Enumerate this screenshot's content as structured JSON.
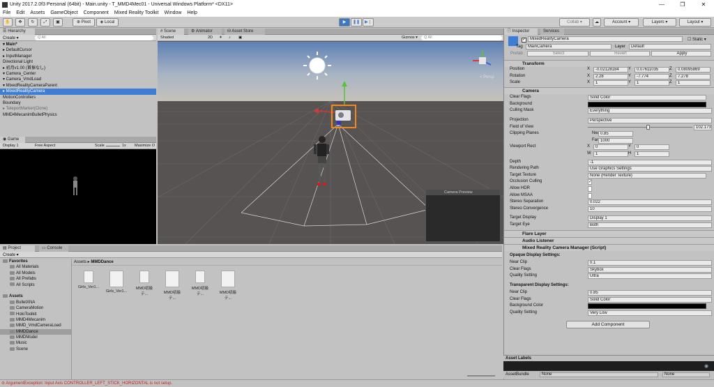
{
  "window": {
    "title": "Unity 2017.2.0f3 Personal (64bit) - Main.unity - T_MMD4Mec01 - Universal Windows Platform* <DX11>",
    "controls": [
      "—",
      "❐",
      "✕"
    ]
  },
  "menu": [
    "File",
    "Edit",
    "Assets",
    "GameObject",
    "Component",
    "Mixed Reality Toolkit",
    "Window",
    "Help"
  ],
  "toolbar": {
    "pivot": "Pivot",
    "local": "Local",
    "collab": "Collab ▾",
    "account": "Account",
    "layers": "Layers",
    "layout": "Layout"
  },
  "hierarchy": {
    "tab": "Hierarchy",
    "create": "Create ▾",
    "search": "Q All",
    "items": [
      {
        "label": "▾ Main*",
        "bold": true
      },
      {
        "label": "▸ DefaultCursor"
      },
      {
        "label": "▸ InputManager"
      },
      {
        "label": "  Directional Light"
      },
      {
        "label": "▸ 初月v1.00 (首振なし)"
      },
      {
        "label": "▾ Camera_Center"
      },
      {
        "label": "  ▾ Camera_VmdLoad"
      },
      {
        "label": "    ▾ MixedRealityCameraParent"
      },
      {
        "label": "      ▸ MixedRealityCamera",
        "selected": true
      },
      {
        "label": "        MotionControllers"
      },
      {
        "label": "        Boundary"
      },
      {
        "label": "▸ TeleportMarker(Clone)",
        "gray": true
      },
      {
        "label": "  MMD4MecanimBulletPhysics"
      }
    ]
  },
  "scene": {
    "tabs": [
      "# Scene",
      "Animator",
      "Asset Store"
    ],
    "shading": "Shaded",
    "mode2d": "2D",
    "gizmos": "Gizmos ▾",
    "search": "Q All",
    "persp": "< Persp",
    "camera_preview": "Camera Preview"
  },
  "game": {
    "tab": "Game",
    "display": "Display 1",
    "aspect": "Free Aspect",
    "scale_label": "Scale",
    "scale_value": "1x",
    "maximize": "Maximize O"
  },
  "project": {
    "tabs": [
      "Project",
      "Console"
    ],
    "create": "Create ▾",
    "breadcrumb_root": "Assets",
    "breadcrumb_current": "MMDDance",
    "favorites_label": "Favorites",
    "favorites": [
      "All Materials",
      "All Models",
      "All Prefabs",
      "All Scripts"
    ],
    "assets_label": "Assets",
    "folders": [
      "BulletXNA",
      "CameraMotion",
      "HoloToolkit",
      "MMD4Mecanim",
      "MMD_VmdCameraLoad",
      "MMDDance",
      "MMDModel",
      "Music",
      "Scene"
    ],
    "selected_folder": "MMDDance",
    "files": [
      "Girls_Ver1...",
      "Girls_Ver1...",
      "MMD初級テ...",
      "MMD初級テ...",
      "MMD初級テ...",
      "MMD初級テ..."
    ]
  },
  "inspector": {
    "tabs": [
      "Inspector",
      "Services"
    ],
    "object_name": "MixedRealityCamera",
    "static_label": "Static",
    "tag_label": "Tag",
    "tag": "MainCamera",
    "layer_label": "Layer",
    "layer": "Default",
    "prefab": {
      "label": "Prefab",
      "select": "Select",
      "revert": "Revert",
      "apply": "Apply"
    },
    "transform": {
      "title": "Transform",
      "position": {
        "label": "Position",
        "x": "-0.02128184",
        "y": "0.07611035",
        "z": "0.08095869"
      },
      "rotation": {
        "label": "Rotation",
        "x": "2.28",
        "y": "-7.774",
        "z": "7.278"
      },
      "scale": {
        "label": "Scale",
        "x": "1",
        "y": "1",
        "z": "1"
      }
    },
    "camera": {
      "title": "Camera",
      "clear_flags": {
        "label": "Clear Flags",
        "value": "Solid Color"
      },
      "background": {
        "label": "Background",
        "color": "#000000"
      },
      "culling_mask": {
        "label": "Culling Mask",
        "value": "Everything"
      },
      "projection": {
        "label": "Projection",
        "value": "Perspective"
      },
      "fov": {
        "label": "Field of View",
        "value": "102.173"
      },
      "clipping": {
        "label": "Clipping Planes",
        "near_label": "Near",
        "near": "0.85",
        "far_label": "Far",
        "far": "1000"
      },
      "viewport": {
        "label": "Viewport Rect",
        "x": "0",
        "y": "0",
        "w": "1",
        "h": "1"
      },
      "depth": {
        "label": "Depth",
        "value": "-1"
      },
      "rendering_path": {
        "label": "Rendering Path",
        "value": "Use Graphics Settings"
      },
      "target_texture": {
        "label": "Target Texture",
        "value": "None (Render Texture)"
      },
      "occlusion": {
        "label": "Occlusion Culling"
      },
      "hdr": {
        "label": "Allow HDR"
      },
      "msaa": {
        "label": "Allow MSAA"
      },
      "stereo_sep": {
        "label": "Stereo Separation",
        "value": "0.022"
      },
      "stereo_conv": {
        "label": "Stereo Convergence",
        "value": "10"
      },
      "target_display": {
        "label": "Target Display",
        "value": "Display 1"
      },
      "target_eye": {
        "label": "Target Eye",
        "value": "Both"
      }
    },
    "flare_layer": "Flare Layer",
    "audio_listener": "Audio Listener",
    "mr_manager": {
      "title": "Mixed Reality Camera Manager (Script)",
      "opaque_title": "Opaque Display Settings:",
      "transparent_title": "Transparent Display Settings:",
      "opaque": {
        "near_label": "Near Clip",
        "near": "0.1",
        "clear_label": "Clear Flags",
        "clear": "Skybox",
        "quality_label": "Quality Setting",
        "quality": "Ultra"
      },
      "transparent": {
        "near_label": "Near Clip",
        "near": "0.85",
        "clear_label": "Clear Flags",
        "clear": "Solid Color",
        "bg_label": "Background Color",
        "quality_label": "Quality Setting",
        "quality": "Very Low"
      }
    },
    "add_component": "Add Component",
    "asset_labels": "Asset Labels",
    "asset_bundle_label": "AssetBundle",
    "asset_bundle_value": "None",
    "asset_bundle_value2": "None"
  },
  "status": {
    "message": "ArgumentException: Input Axis CONTROLLER_LEFT_STICK_HORIZONTAL is not setup."
  },
  "colors": {
    "selection": "#3d7dd6",
    "play_active": "#3a78c8",
    "annotation_circle": "#e0252b",
    "error": "#c81e1e"
  }
}
